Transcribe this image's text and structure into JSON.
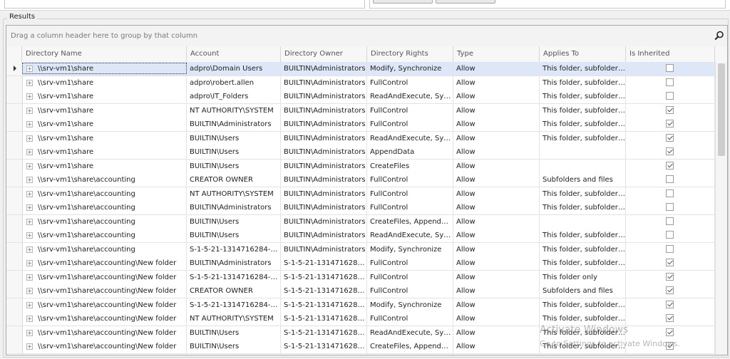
{
  "results_label": "Results",
  "group_panel_hint": "Drag a column header here to group by that column",
  "columns": [
    {
      "label": "Directory Name"
    },
    {
      "label": "Account"
    },
    {
      "label": "Directory Owner"
    },
    {
      "label": "Directory Rights"
    },
    {
      "label": "Type"
    },
    {
      "label": "Applies To"
    },
    {
      "label": "Is Inherited"
    }
  ],
  "rows": [
    {
      "dir": "\\\\srv-vm1\\share",
      "account": "adpro\\Domain Users",
      "owner": "BUILTIN\\Administrators",
      "rights": "Modify, Synchronize",
      "type": "Allow",
      "applies": "This folder, subfolders ...",
      "inherited": false,
      "selected": true
    },
    {
      "dir": "\\\\srv-vm1\\share",
      "account": "adpro\\robert.allen",
      "owner": "BUILTIN\\Administrators",
      "rights": "FullControl",
      "type": "Allow",
      "applies": "This folder, subfolders ...",
      "inherited": false
    },
    {
      "dir": "\\\\srv-vm1\\share",
      "account": "adpro\\IT_Folders",
      "owner": "BUILTIN\\Administrators",
      "rights": "ReadAndExecute, Sync...",
      "type": "Allow",
      "applies": "This folder, subfolders ...",
      "inherited": false
    },
    {
      "dir": "\\\\srv-vm1\\share",
      "account": "NT AUTHORITY\\SYSTEM",
      "owner": "BUILTIN\\Administrators",
      "rights": "FullControl",
      "type": "Allow",
      "applies": "This folder, subfolders ...",
      "inherited": true
    },
    {
      "dir": "\\\\srv-vm1\\share",
      "account": "BUILTIN\\Administrators",
      "owner": "BUILTIN\\Administrators",
      "rights": "FullControl",
      "type": "Allow",
      "applies": "This folder, subfolders ...",
      "inherited": true
    },
    {
      "dir": "\\\\srv-vm1\\share",
      "account": "BUILTIN\\Users",
      "owner": "BUILTIN\\Administrators",
      "rights": "ReadAndExecute, Sync...",
      "type": "Allow",
      "applies": "This folder, subfolders ...",
      "inherited": true
    },
    {
      "dir": "\\\\srv-vm1\\share",
      "account": "BUILTIN\\Users",
      "owner": "BUILTIN\\Administrators",
      "rights": "AppendData",
      "type": "Allow",
      "applies": "",
      "inherited": true
    },
    {
      "dir": "\\\\srv-vm1\\share",
      "account": "BUILTIN\\Users",
      "owner": "BUILTIN\\Administrators",
      "rights": "CreateFiles",
      "type": "Allow",
      "applies": "",
      "inherited": true
    },
    {
      "dir": "\\\\srv-vm1\\share\\accounting",
      "account": "CREATOR OWNER",
      "owner": "BUILTIN\\Administrators",
      "rights": "FullControl",
      "type": "Allow",
      "applies": "Subfolders and files",
      "inherited": false
    },
    {
      "dir": "\\\\srv-vm1\\share\\accounting",
      "account": "NT AUTHORITY\\SYSTEM",
      "owner": "BUILTIN\\Administrators",
      "rights": "FullControl",
      "type": "Allow",
      "applies": "This folder, subfolders ...",
      "inherited": false
    },
    {
      "dir": "\\\\srv-vm1\\share\\accounting",
      "account": "BUILTIN\\Administrators",
      "owner": "BUILTIN\\Administrators",
      "rights": "FullControl",
      "type": "Allow",
      "applies": "This folder, subfolders ...",
      "inherited": false
    },
    {
      "dir": "\\\\srv-vm1\\share\\accounting",
      "account": "BUILTIN\\Users",
      "owner": "BUILTIN\\Administrators",
      "rights": "CreateFiles, AppendDa...",
      "type": "Allow",
      "applies": "",
      "inherited": false
    },
    {
      "dir": "\\\\srv-vm1\\share\\accounting",
      "account": "BUILTIN\\Users",
      "owner": "BUILTIN\\Administrators",
      "rights": "ReadAndExecute, Sync...",
      "type": "Allow",
      "applies": "This folder, subfolders ...",
      "inherited": false
    },
    {
      "dir": "\\\\srv-vm1\\share\\accounting",
      "account": "S-1-5-21-1314716284-17...",
      "owner": "BUILTIN\\Administrators",
      "rights": "Modify, Synchronize",
      "type": "Allow",
      "applies": "This folder, subfolders ...",
      "inherited": false
    },
    {
      "dir": "\\\\srv-vm1\\share\\accounting\\New folder",
      "account": "BUILTIN\\Administrators",
      "owner": "S-1-5-21-1314716284-...",
      "rights": "FullControl",
      "type": "Allow",
      "applies": "This folder, subfolders ...",
      "inherited": true
    },
    {
      "dir": "\\\\srv-vm1\\share\\accounting\\New folder",
      "account": "S-1-5-21-1314716284-17...",
      "owner": "S-1-5-21-1314716284-...",
      "rights": "FullControl",
      "type": "Allow",
      "applies": "This folder only",
      "inherited": true
    },
    {
      "dir": "\\\\srv-vm1\\share\\accounting\\New folder",
      "account": "CREATOR OWNER",
      "owner": "S-1-5-21-1314716284-...",
      "rights": "FullControl",
      "type": "Allow",
      "applies": "Subfolders and files",
      "inherited": true
    },
    {
      "dir": "\\\\srv-vm1\\share\\accounting\\New folder",
      "account": "S-1-5-21-1314716284-17...",
      "owner": "S-1-5-21-1314716284-...",
      "rights": "Modify, Synchronize",
      "type": "Allow",
      "applies": "This folder, subfolders ...",
      "inherited": true
    },
    {
      "dir": "\\\\srv-vm1\\share\\accounting\\New folder",
      "account": "NT AUTHORITY\\SYSTEM",
      "owner": "S-1-5-21-1314716284-...",
      "rights": "FullControl",
      "type": "Allow",
      "applies": "This folder, subfolders ...",
      "inherited": true
    },
    {
      "dir": "\\\\srv-vm1\\share\\accounting\\New folder",
      "account": "BUILTIN\\Users",
      "owner": "S-1-5-21-1314716284-...",
      "rights": "ReadAndExecute, Sync...",
      "type": "Allow",
      "applies": "This folder, subfolders ...",
      "inherited": true
    },
    {
      "dir": "\\\\srv-vm1\\share\\accounting\\New folder",
      "account": "BUILTIN\\Users",
      "owner": "S-1-5-21-1314716284-...",
      "rights": "CreateFiles, AppendDa...",
      "type": "Allow",
      "applies": "This folder, subfolders ...",
      "inherited": true
    }
  ],
  "watermark": {
    "line1": "Activate Windows",
    "line2": "Go to Settings to activate Windows."
  },
  "icons": {
    "search": "search-icon",
    "row_indicator": "row-indicator-arrow-icon",
    "expand": "expand-plus-icon"
  },
  "colors": {
    "selected_row": "#dde7f7",
    "grid_border": "#a9a9a9"
  }
}
